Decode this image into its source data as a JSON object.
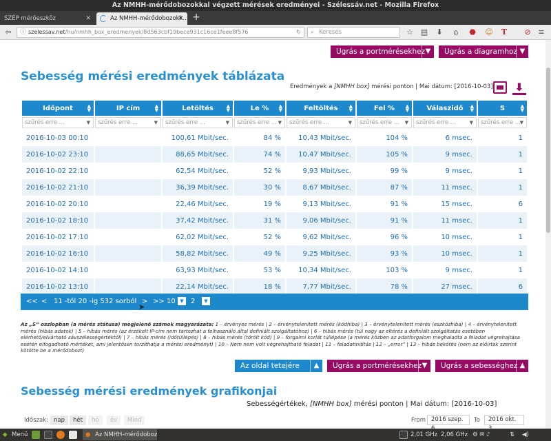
{
  "window": {
    "title": "Az NMHH-mérődobozokkal végzett mérések eredményei - Szélessáv.net - Mozilla Firefox"
  },
  "tabs": [
    {
      "label": "SZÉP mérőeszköz"
    },
    {
      "label": "Az NMHH-mérődobozokk..."
    }
  ],
  "navbar": {
    "url_host": "szelessav.net",
    "url_path": "/hu/nmhh_box_eredmenyek/8d563cbf19bece931c16ce1feee8f576",
    "search_placeholder": "Keresés"
  },
  "top_buttons": {
    "portmeres": "Ugrás a portmérésekhez",
    "diagram": "Ugrás a diagramhoz"
  },
  "section1": {
    "title": "Sebesség mérési eredmények táblázata",
    "meta_prefix": "Eredmények a",
    "meta_box": "[NMHH box]",
    "meta_suffix": "mérési ponton | Mai dátum: [2016-10-03]"
  },
  "table": {
    "columns": [
      "Időpont",
      "IP cím",
      "Letöltés",
      "Le %",
      "Feltöltés",
      "Fel %",
      "Válaszidő",
      "S"
    ],
    "filter_placeholder": "szűrés erre ...",
    "rows": [
      [
        "2016-10-03 00:10",
        "",
        "100,61 Mbit/sec.",
        "84 %",
        "10,43 Mbit/sec.",
        "104 %",
        "6 msec.",
        "1"
      ],
      [
        "2016-10-02 23:10",
        "",
        "88,65 Mbit/sec.",
        "74 %",
        "10,47 Mbit/sec.",
        "105 %",
        "9 msec.",
        "1"
      ],
      [
        "2016-10-02 22:10",
        "",
        "62,54 Mbit/sec.",
        "52 %",
        "9,93 Mbit/sec.",
        "99 %",
        "9 msec.",
        "1"
      ],
      [
        "2016-10-02 21:10",
        "",
        "36,39 Mbit/sec.",
        "30 %",
        "8,67 Mbit/sec.",
        "87 %",
        "11 msec.",
        "1"
      ],
      [
        "2016-10-02 20:10",
        "",
        "22,46 Mbit/sec.",
        "19 %",
        "9,13 Mbit/sec.",
        "91 %",
        "15 msec.",
        "6"
      ],
      [
        "2016-10-02 18:10",
        "",
        "37,42 Mbit/sec.",
        "31 %",
        "9,06 Mbit/sec.",
        "91 %",
        "11 msec.",
        "1"
      ],
      [
        "2016-10-02 17:10",
        "",
        "62,02 Mbit/sec.",
        "52 %",
        "9,62 Mbit/sec.",
        "96 %",
        "10 msec.",
        "1"
      ],
      [
        "2016-10-02 16:10",
        "",
        "58,82 Mbit/sec.",
        "49 %",
        "9,25 Mbit/sec.",
        "93 %",
        "10 msec.",
        "1"
      ],
      [
        "2016-10-02 14:10",
        "",
        "63,93 Mbit/sec.",
        "53 %",
        "10,34 Mbit/sec.",
        "103 %",
        "9 msec.",
        "1"
      ],
      [
        "2016-10-02 13:10",
        "",
        "22,14 Mbit/sec.",
        "18 %",
        "7,77 Mbit/sec.",
        "78 %",
        "27 msec.",
        "6"
      ]
    ]
  },
  "pager": {
    "first": "<<",
    "prev": "<",
    "info": "11 -től 20 -ig 532 sorból",
    "next": ">",
    "last": ">>",
    "per_page": "10",
    "page": "2"
  },
  "legend": {
    "intro": "Az „S” oszlopban (a mérés státusa) megjelenő számok magyarázata:",
    "text": " 1 – érvényes mérés | 2 – érvénytelenített mérés (kódhiba) | 3 – érvénytelenített mérés (eszközhiba) | 4 – érvénytelenített mérés (hibás adatok) | 5 – hibás mérés (az érzékelt IP-cím nem tartozhat a felhasználó által definiált szolgáltatóhoz) | 6 – hibás mérés (túl nagy az eltérés a definiált szolgáltatás esetében elérhető/elvárható sávszélességértéktől) | 7 – hibás mérés (időtúllépés) | 8 – hibás mérés (törölt kód) | 9 – forgalmi korlát túllépése (a mérés közben az adatforgalom meghaladta a feladat végrehajtása esetén elfogadható mértéket, ami jelentősen torzíthatja a mérési eredményt) | 10 – Nem nem volt végrehajtható feladat | 11 – feladatindítás | 12 – „error” | 13 – hibás bekötés (nem az előírtak szerint kötötte be a mérődobozt)"
  },
  "bottom_buttons": {
    "top": "Az oldal tetejére",
    "portmeres": "Ugrás a portmérésekhez",
    "sebesseg": "Ugrás a sebességhez"
  },
  "section2": {
    "title": "Sebesség mérési eredmények grafikonjai",
    "meta_prefix": "Sebességértékek,",
    "meta_box": "[NMHH box]",
    "meta_suffix": "mérési ponton | Mai dátum: [2016-10-03]",
    "period_label": "Időszak:",
    "periods": [
      "nap",
      "hét",
      "hó",
      "év",
      "Mind"
    ],
    "from_label": "From",
    "from_value": "2016 szep. 6.",
    "to_label": "To",
    "to_value": "2016 okt. 3."
  },
  "taskbar": {
    "menu": "Menü",
    "task": "Az NMHH-mérődoboz...",
    "cpu1": "2,01 GHz",
    "cpu2": "2,06 GHz"
  },
  "colors": {
    "brand_blue": "#1e88cc",
    "brand_purple": "#960a64",
    "title_blue": "#2a8fd0"
  }
}
